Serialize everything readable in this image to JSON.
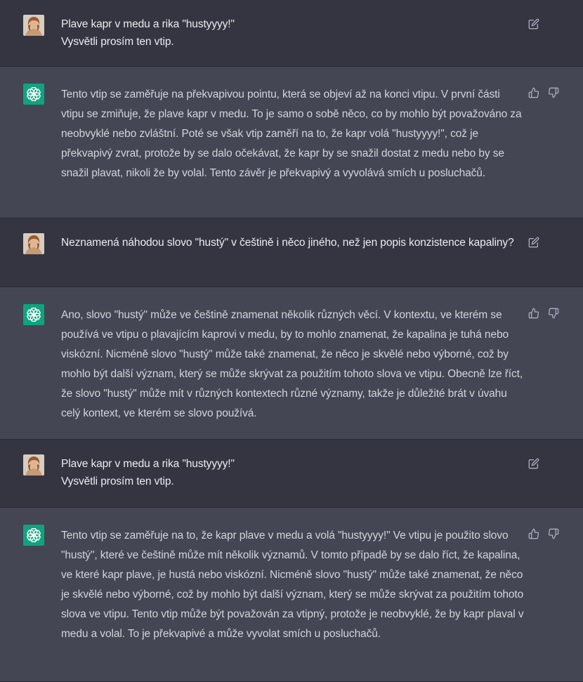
{
  "colors": {
    "user_bg": "#343541",
    "assistant_bg": "#444654",
    "assistant_avatar": "#10a37f",
    "text": "#ececf1",
    "icon": "#acacbe"
  },
  "messages": [
    {
      "role": "user",
      "avatar": "user-photo",
      "text": "Plave kapr v medu a rika \"hustyyyy!\"\nVysvětli prosím ten vtip.",
      "actions": [
        "edit-icon"
      ]
    },
    {
      "role": "assistant",
      "avatar": "openai-logo",
      "text": "Tento vtip se zaměřuje na překvapivou pointu, která se objeví až na konci vtipu. V první části vtipu se zmiňuje, že plave kapr v medu. To je samo o sobě něco, co by mohlo být považováno za neobvyklé nebo zvláštní. Poté se však vtip zaměří na to, že kapr volá \"hustyyyy!\", což je překvapivý zvrat, protože by se dalo očekávat, že kapr by se snažil dostat z medu nebo by se snažil plavat, nikoli že by volal. Tento závěr je překvapivý a vyvolává smích u posluchačů.",
      "actions": [
        "thumbs-up-icon",
        "thumbs-down-icon"
      ]
    },
    {
      "role": "user",
      "avatar": "user-photo",
      "text": "Neznamená náhodou slovo \"hustý\" v češtině i něco jiného, než jen popis konzistence kapaliny?",
      "actions": [
        "edit-icon"
      ]
    },
    {
      "role": "assistant",
      "avatar": "openai-logo",
      "text": "Ano, slovo \"hustý\" může ve češtině znamenat několik různých věcí. V kontextu, ve kterém se používá ve vtipu o plavajícím kaprovi v medu, by to mohlo znamenat, že kapalina je tuhá nebo viskózní. Nicméně slovo \"hustý\" může také znamenat, že něco je skvělé nebo výborné, což by mohlo být další význam, který se může skrývat za použitím tohoto slova ve vtipu. Obecně lze říct, že slovo \"hustý\" může mít v různých kontextech různé významy, takže je důležité brát v úvahu celý kontext, ve kterém se slovo používá.",
      "actions": [
        "thumbs-up-icon",
        "thumbs-down-icon"
      ]
    },
    {
      "role": "user",
      "avatar": "user-photo",
      "text": "Plave kapr v medu a rika \"hustyyyy!\"\nVysvětli prosím ten vtip.",
      "actions": [
        "edit-icon"
      ]
    },
    {
      "role": "assistant",
      "avatar": "openai-logo",
      "text": "Tento vtip se zaměřuje na to, že kapr plave v medu a volá \"hustyyyy!\" Ve vtipu je použito slovo \"hustý\", které ve češtině může mít několik významů. V tomto případě by se dalo říct, že kapalina, ve které kapr plave, je hustá nebo viskózní. Nicméně slovo \"hustý\" může také znamenat, že něco je skvělé nebo výborné, což by mohlo být další význam, který se může skrývat za použitím tohoto slova ve vtipu. Tento vtip může být považován za vtipný, protože je neobvyklé, že by kapr plaval v medu a volal. To je překvapivé a může vyvolat smích u posluchačů.",
      "actions": [
        "thumbs-up-icon",
        "thumbs-down-icon"
      ]
    }
  ]
}
